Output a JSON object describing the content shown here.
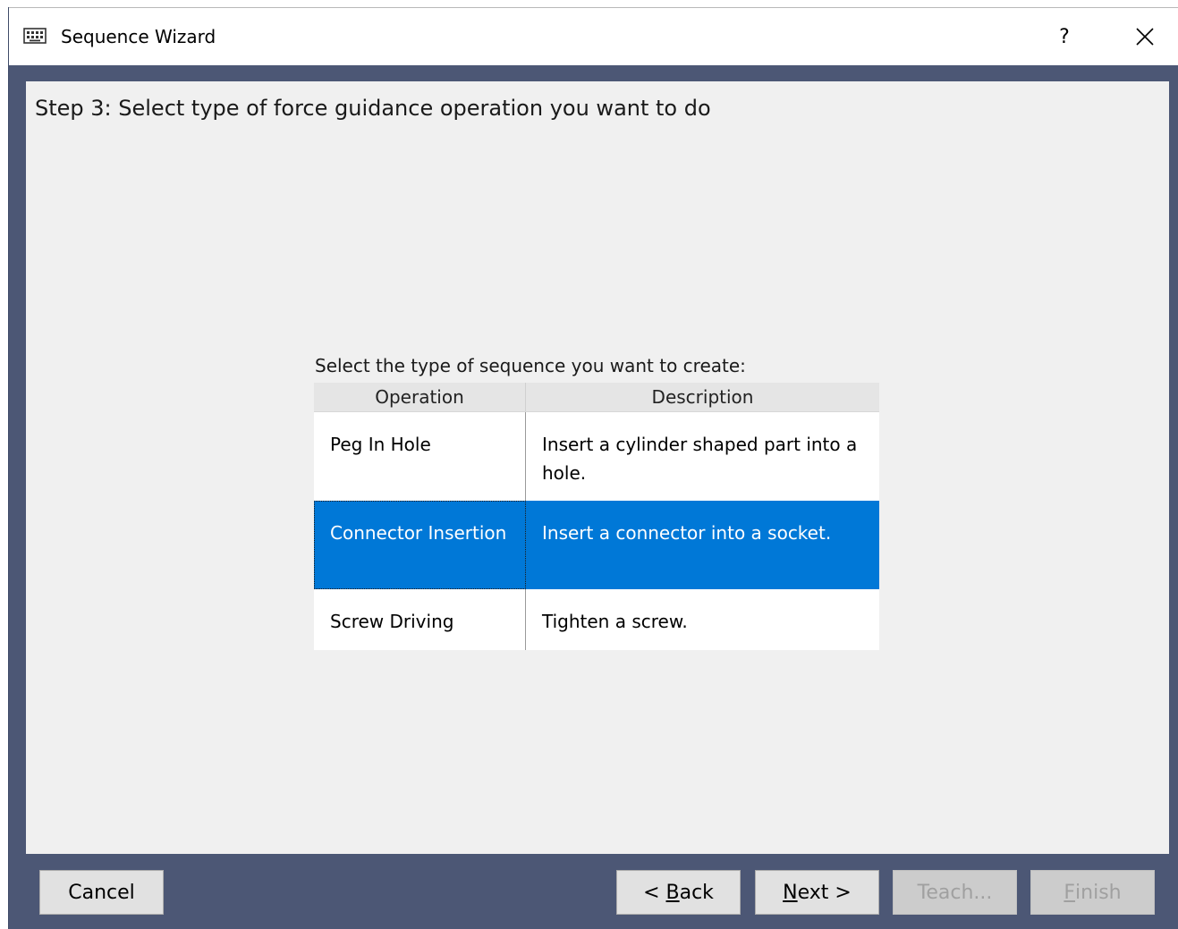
{
  "window": {
    "title": "Sequence Wizard",
    "help_label": "?",
    "app_icon": "keyboard-icon",
    "close_icon": "close-icon"
  },
  "step": {
    "title": "Step 3: Select type of force guidance operation you want to do"
  },
  "selection": {
    "prompt": "Select the type of sequence you want to create:",
    "columns": [
      "Operation",
      "Description"
    ],
    "rows": [
      {
        "operation": "Peg In Hole",
        "description": "Insert a cylinder shaped part into a hole.",
        "selected": false
      },
      {
        "operation": "Connector Insertion",
        "description": "Insert a connector into a socket.",
        "selected": true
      },
      {
        "operation": "Screw Driving",
        "description": "Tighten a screw.",
        "selected": false
      }
    ]
  },
  "buttons": {
    "cancel": "Cancel",
    "back": {
      "prefix": "< ",
      "mnemonic": "B",
      "rest": "ack"
    },
    "next": {
      "mnemonic": "N",
      "rest": "ext >"
    },
    "teach": "Teach...",
    "finish": {
      "mnemonic": "F",
      "rest": "inish"
    }
  },
  "colors": {
    "selection": "#0078d7",
    "frame": "#4c5775",
    "content_background": "#f0f0f0"
  }
}
